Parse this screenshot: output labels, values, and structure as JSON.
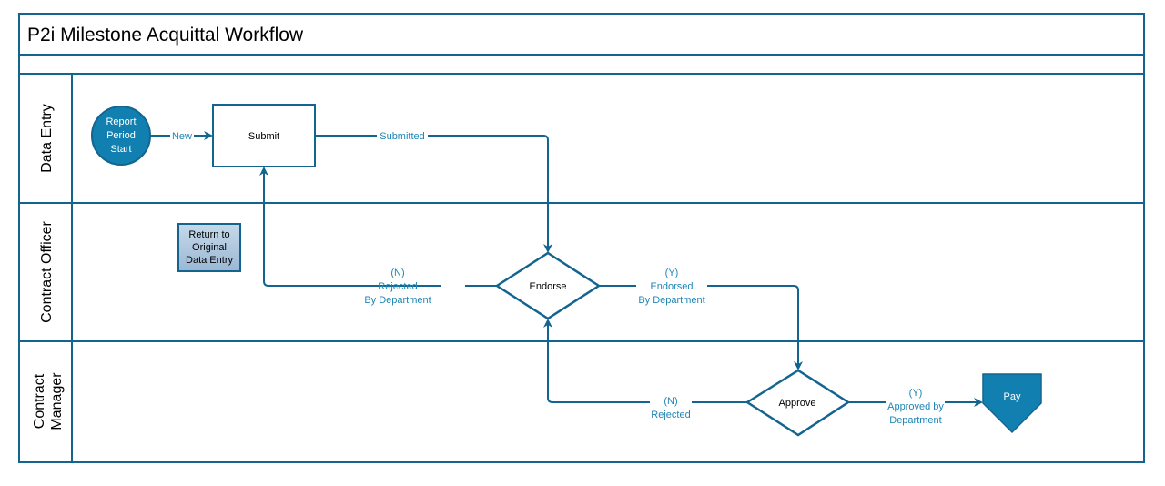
{
  "diagram": {
    "title": "P2i Milestone Acquittal Workflow",
    "colors": {
      "line": "#13658f",
      "accent_fill": "#117fb0",
      "label_text": "#1f86b5",
      "note_fill_top": "#c6d9ea",
      "note_fill_bottom": "#9ab8d4"
    },
    "lanes": [
      {
        "id": "data-entry",
        "label": "Data Entry"
      },
      {
        "id": "contract-officer",
        "label": "Contract Officer"
      },
      {
        "id": "contract-manager",
        "label_lines": [
          "Contract",
          "Manager"
        ]
      }
    ],
    "nodes": {
      "start": {
        "type": "start-circle",
        "lines": [
          "Report",
          "Period",
          "Start"
        ]
      },
      "submit": {
        "type": "process",
        "label": "Submit"
      },
      "note": {
        "type": "annotation",
        "lines": [
          "Return to",
          "Original",
          "Data Entry"
        ]
      },
      "endorse": {
        "type": "decision",
        "label": "Endorse"
      },
      "approve": {
        "type": "decision",
        "label": "Approve"
      },
      "pay": {
        "type": "off-page-connector",
        "label": "Pay"
      }
    },
    "edges": [
      {
        "from": "start",
        "to": "submit",
        "lines": [
          "New"
        ]
      },
      {
        "from": "submit",
        "to": "endorse",
        "lines": [
          "Submitted"
        ]
      },
      {
        "from": "endorse",
        "to": "submit",
        "lines": [
          "(N)",
          "Rejected",
          "By Department"
        ]
      },
      {
        "from": "endorse",
        "to": "approve",
        "lines": [
          "(Y)",
          "Endorsed",
          "By Department"
        ]
      },
      {
        "from": "approve",
        "to": "endorse",
        "lines": [
          "(N)",
          "Rejected"
        ]
      },
      {
        "from": "approve",
        "to": "pay",
        "lines": [
          "(Y)",
          "Approved by",
          "Department"
        ]
      }
    ]
  }
}
